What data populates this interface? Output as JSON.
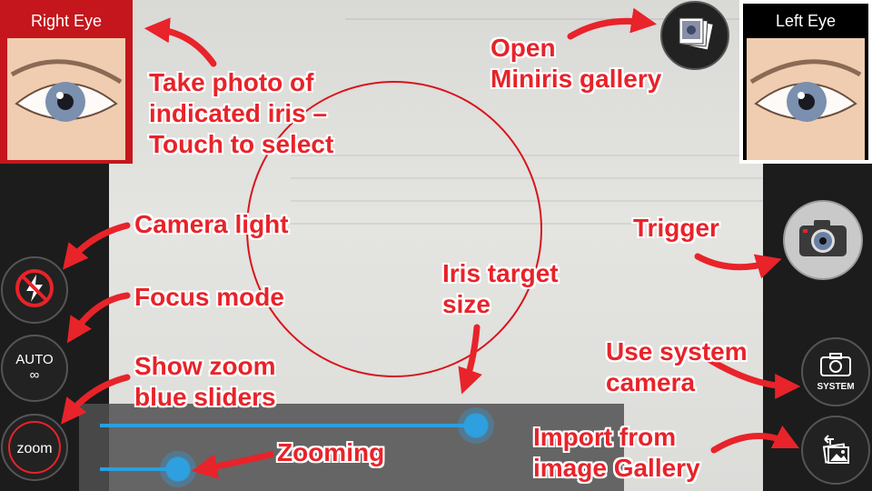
{
  "tiles": {
    "right_eye_label": "Right Eye",
    "left_eye_label": "Left Eye"
  },
  "controls": {
    "auto_label": "AUTO",
    "auto_sub": "∞",
    "zoom_label": "zoom",
    "system_label": "SYSTEM",
    "flash_icon": "flash-off-icon",
    "camera_icon": "camera-icon",
    "gallery_icon": "gallery-stack-icon",
    "import_icon": "image-import-icon"
  },
  "annotations": {
    "take_photo": [
      "Take photo of",
      "indicated iris –",
      "Touch to select"
    ],
    "open_gallery": [
      "Open",
      "Miniris gallery"
    ],
    "camera_light": "Camera light",
    "focus_mode": "Focus mode",
    "show_zoom": [
      "Show zoom",
      "blue sliders"
    ],
    "trigger": "Trigger",
    "iris_target": [
      "Iris target",
      "size"
    ],
    "use_system": [
      "Use system",
      "camera"
    ],
    "zooming": "Zooming",
    "import_gallery": [
      "Import from",
      "image Gallery"
    ]
  },
  "sliders": {
    "iris_size_fraction": 0.72,
    "zoom_fraction": 0.15
  },
  "colors": {
    "annotation": "#e8232a",
    "selected_tile": "#c4161c",
    "slider": "#2a9fe0",
    "target_circle": "#d8141b"
  }
}
